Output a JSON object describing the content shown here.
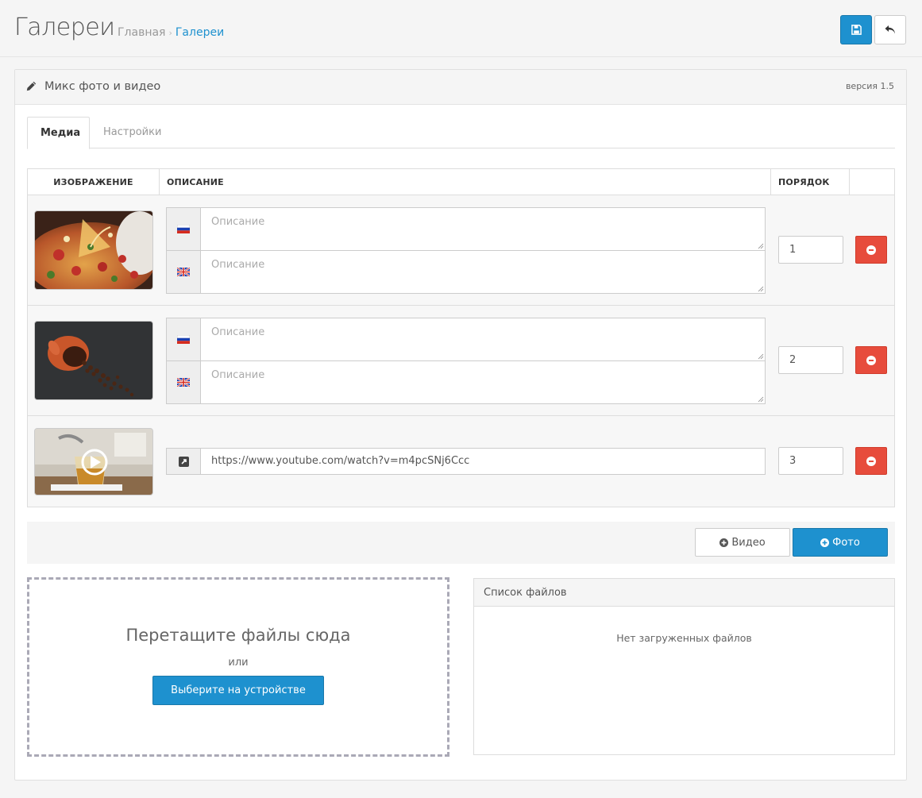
{
  "header": {
    "title": "Галереи",
    "breadcrumb": {
      "home": "Главная",
      "separator": "›",
      "current": "Галереи"
    }
  },
  "panel": {
    "title": "Микс фото и видео",
    "version": "версия 1.5"
  },
  "tabs": [
    {
      "label": "Медиа",
      "active": true
    },
    {
      "label": "Настройки",
      "active": false
    }
  ],
  "table": {
    "headers": {
      "image": "ИЗОБРАЖЕНИЕ",
      "description": "ОПИСАНИЕ",
      "order": "ПОРЯДОК"
    },
    "rows": [
      {
        "type": "photo",
        "thumb": "pizza",
        "descriptions": [
          {
            "lang": "ru",
            "placeholder": "Описание"
          },
          {
            "lang": "en",
            "placeholder": "Описание"
          }
        ],
        "order": "1"
      },
      {
        "type": "photo",
        "thumb": "coffee",
        "descriptions": [
          {
            "lang": "ru",
            "placeholder": "Описание"
          },
          {
            "lang": "en",
            "placeholder": "Описание"
          }
        ],
        "order": "2"
      },
      {
        "type": "video",
        "thumb": "tea-video",
        "url": "https://www.youtube.com/watch?v=m4pcSNj6Ccc",
        "order": "3"
      }
    ]
  },
  "actions": {
    "add_video": "Видео",
    "add_photo": "Фото"
  },
  "upload": {
    "drop_text": "Перетащите файлы сюда",
    "or_text": "или",
    "choose_button": "Выберите на устройстве"
  },
  "files": {
    "title": "Список файлов",
    "empty": "Нет загруженных файлов"
  },
  "colors": {
    "primary": "#1e91cf",
    "danger": "#e74c3c"
  }
}
